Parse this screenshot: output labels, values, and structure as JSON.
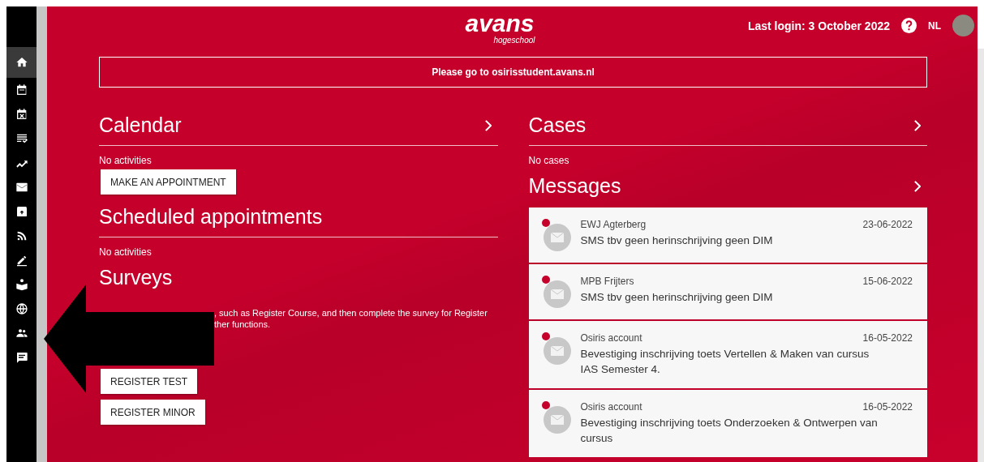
{
  "sidebar": {
    "items": [
      {
        "kind": "home",
        "selected": true
      },
      {
        "kind": "calendar",
        "selected": false
      },
      {
        "kind": "calendar-x",
        "selected": false
      },
      {
        "kind": "checklist",
        "selected": false
      },
      {
        "kind": "trend",
        "selected": false
      },
      {
        "kind": "mail",
        "selected": false
      },
      {
        "kind": "archive",
        "selected": false
      },
      {
        "kind": "rss",
        "selected": false
      },
      {
        "kind": "pen",
        "selected": false
      },
      {
        "kind": "reader",
        "selected": false
      },
      {
        "kind": "globe",
        "selected": false
      },
      {
        "kind": "people",
        "selected": false
      },
      {
        "kind": "feedback",
        "selected": false
      }
    ]
  },
  "header": {
    "logo": "avans",
    "logo_sub": "hogeschool",
    "last_login": "Last login: 3 October 2022",
    "language": "NL"
  },
  "banner": "Please go to osirisstudent.avans.nl",
  "left": [
    {
      "title": "Calendar",
      "chevron": true,
      "ruled": true,
      "text": "No activities",
      "buttons": [
        "MAKE AN APPOINTMENT"
      ]
    },
    {
      "title": "Scheduled appointments",
      "chevron": false,
      "ruled": true,
      "text": "No activities"
    },
    {
      "title": "Surveys",
      "chevron": false,
      "ruled": false,
      "text_lines": [
        ", such as Register Course, and then complete the survey for Register",
        "ther functions."
      ],
      "buttons": [
        "REGISTER TEST",
        "REGISTER MINOR"
      ]
    }
  ],
  "right": {
    "cases": {
      "title": "Cases",
      "text": "No cases"
    },
    "messages": {
      "title": "Messages",
      "items": [
        {
          "sender": "EWJ Agterberg",
          "date": "23-06-2022",
          "subject": "SMS tbv geen herinschrijving geen DIM",
          "unread": true
        },
        {
          "sender": "MPB Frijters",
          "date": "15-06-2022",
          "subject": "SMS tbv geen herinschrijving geen DIM",
          "unread": true
        },
        {
          "sender": "Osiris account",
          "date": "16-05-2022",
          "subject": "Bevestiging inschrijving toets Vertellen & Maken van cursus IAS Semester 4.",
          "unread": true
        },
        {
          "sender": "Osiris account",
          "date": "16-05-2022",
          "subject": "Bevestiging inschrijving toets Onderzoeken & Ontwerpen van cursus",
          "unread": true
        }
      ]
    }
  }
}
